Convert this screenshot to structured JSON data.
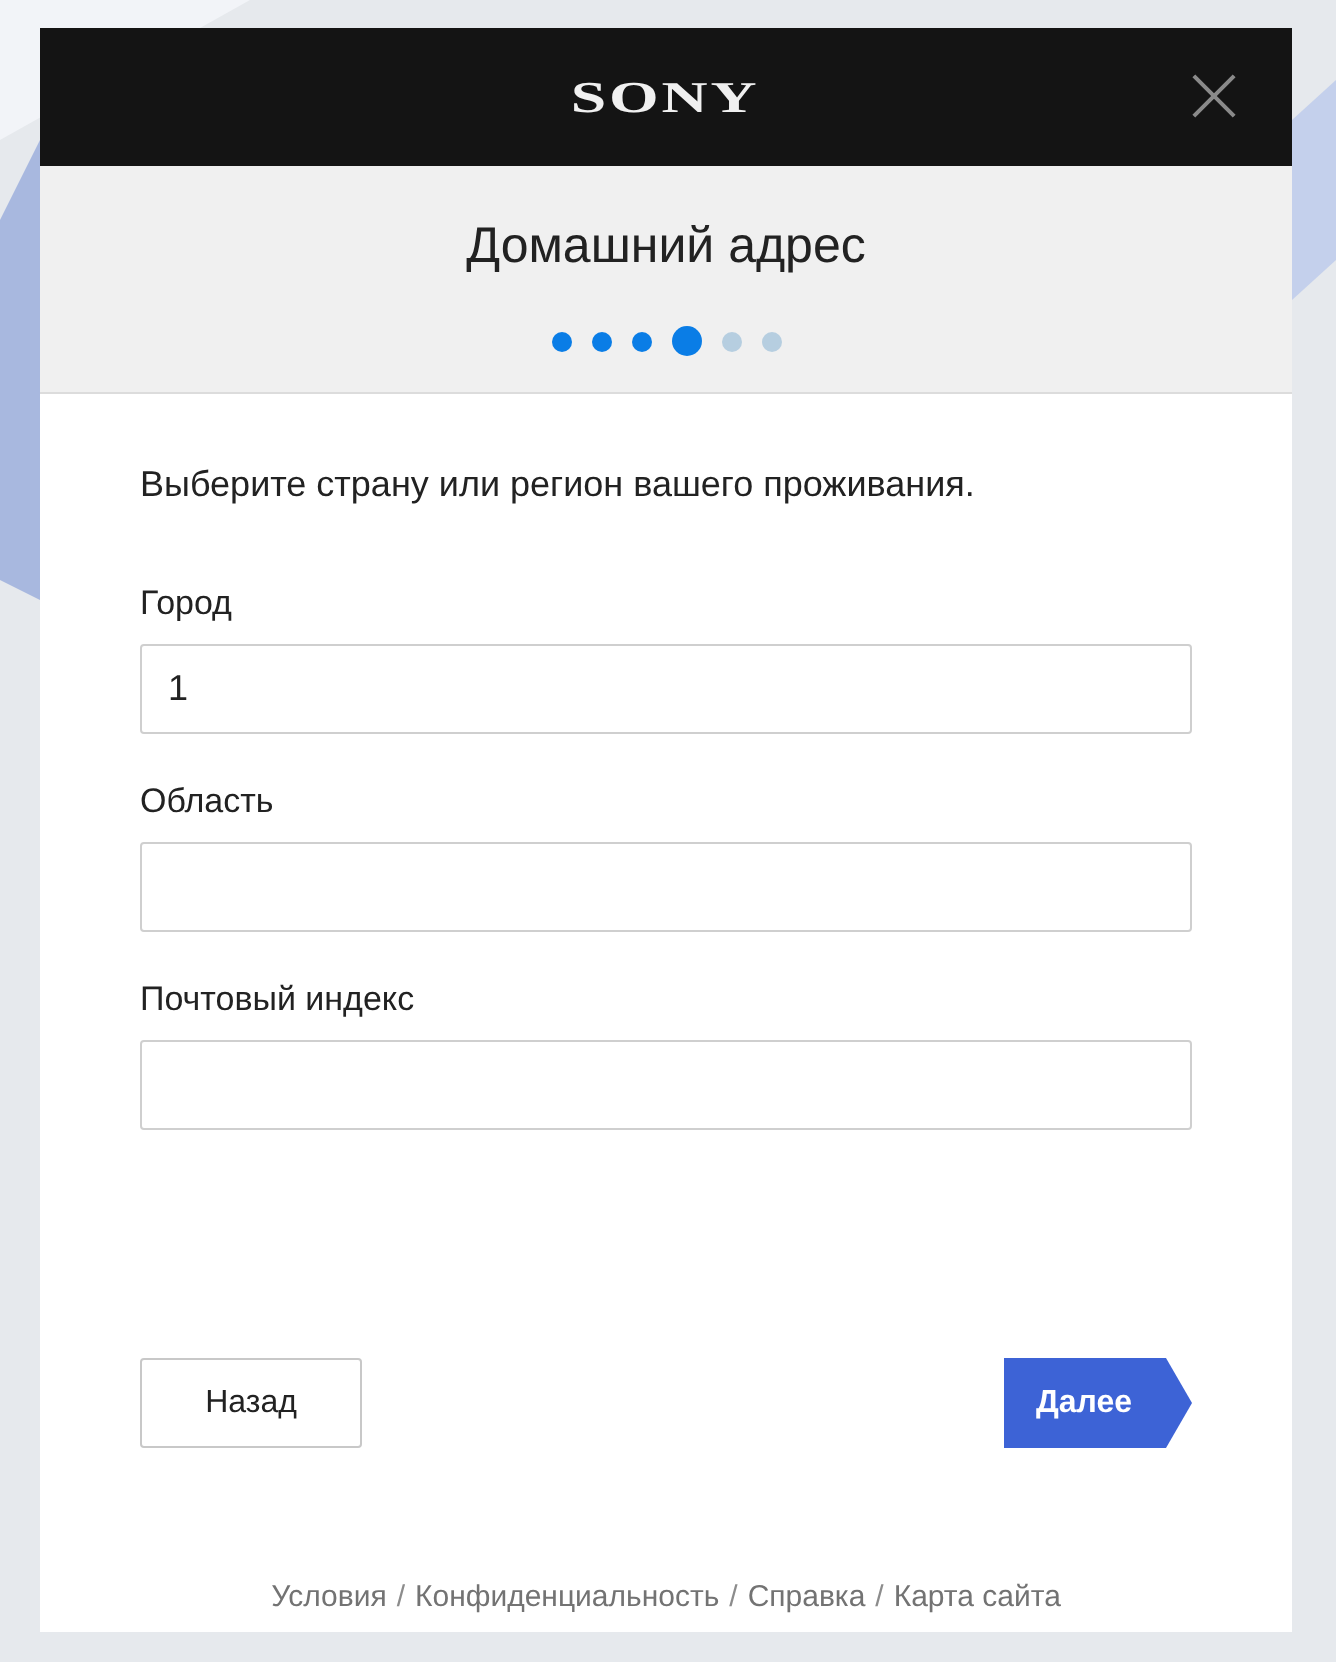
{
  "header": {
    "logo": "SONY"
  },
  "panel": {
    "title": "Домашний адрес",
    "steps": [
      {
        "completed": true,
        "selected": false
      },
      {
        "completed": true,
        "selected": false
      },
      {
        "completed": true,
        "selected": false
      },
      {
        "completed": false,
        "selected": true
      },
      {
        "completed": false,
        "selected": false
      },
      {
        "completed": false,
        "selected": false
      }
    ]
  },
  "form": {
    "intro": "Выберите страну или регион вашего проживания.",
    "fields": [
      {
        "label": "Город",
        "value": "1"
      },
      {
        "label": "Область"
      },
      {
        "label": "Почтовый индекс"
      }
    ]
  },
  "buttons": [
    {
      "kind": "back",
      "label": "Назад"
    },
    {
      "kind": "next",
      "label": "Далее"
    }
  ],
  "footer": [
    {
      "kind": "link",
      "text": "Условия"
    },
    {
      "kind": "separator",
      "text": "/"
    },
    {
      "kind": "link",
      "text": "Конфиденциальность"
    },
    {
      "kind": "separator",
      "text": "/"
    },
    {
      "kind": "link",
      "text": "Справка"
    },
    {
      "kind": "separator",
      "text": "/"
    },
    {
      "kind": "link",
      "text": "Карта сайта"
    }
  ]
}
